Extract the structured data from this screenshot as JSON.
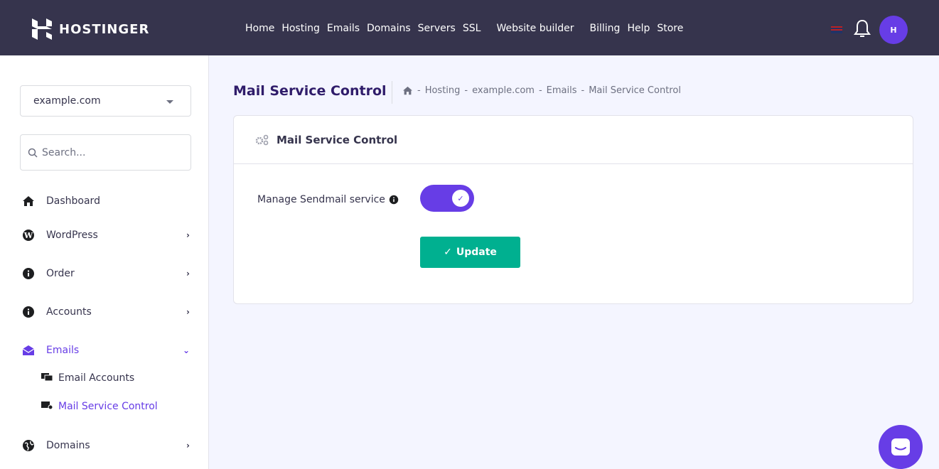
{
  "brand": {
    "name": "HOSTINGER",
    "avatar_text": "H"
  },
  "nav": {
    "items": [
      "Home",
      "Hosting",
      "Emails",
      "Domains",
      "Servers",
      "SSL",
      "Website builder",
      "Billing",
      "Help",
      "Store"
    ]
  },
  "sidebar": {
    "domain_select": "example.com",
    "search_placeholder": "Search...",
    "items": [
      {
        "label": "Dashboard",
        "icon": "home-icon"
      },
      {
        "label": "WordPress",
        "icon": "wordpress-icon"
      },
      {
        "label": "Order",
        "icon": "info-icon"
      },
      {
        "label": "Accounts",
        "icon": "info-icon"
      },
      {
        "label": "Emails",
        "icon": "envelope-open-icon"
      },
      {
        "label": "Domains",
        "icon": "globe-icon"
      }
    ],
    "sub_items": [
      {
        "label": "Email Accounts",
        "icon": "mail-bulk-icon"
      },
      {
        "label": "Mail Service Control",
        "icon": "mail-settings-icon"
      }
    ]
  },
  "main": {
    "title": "Mail Service Control",
    "breadcrumb": [
      "Hosting",
      "example.com",
      "Emails",
      "Mail Service Control"
    ],
    "breadcrumb_sep": "-",
    "card_title": "Mail Service Control",
    "field_label": "Manage Sendmail service",
    "toggle_on": true,
    "button_label": "Update"
  },
  "colors": {
    "brand": "#673de6",
    "topbar": "#36344d",
    "success": "#00b090"
  }
}
